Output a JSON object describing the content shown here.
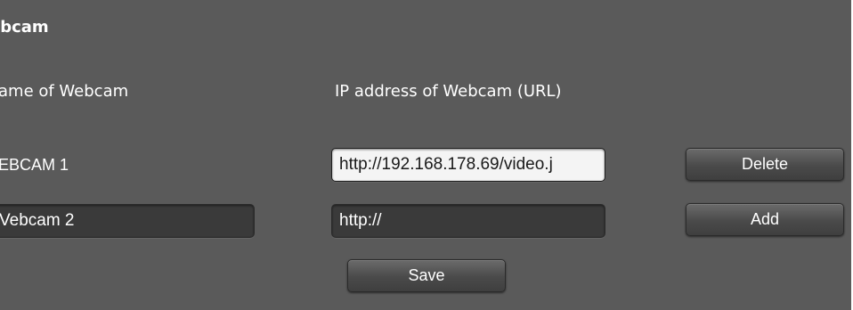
{
  "section": {
    "title": "ebcam"
  },
  "columns": {
    "name_header": "ame of Webcam",
    "url_header": "IP address of Webcam (URL)"
  },
  "rows": [
    {
      "name": "EBCAM 1",
      "url": "http://192.168.178.69/video.j",
      "action": "Delete"
    },
    {
      "name": "Vebcam 2",
      "url": "http://",
      "action": "Add"
    }
  ],
  "save_label": "Save",
  "colors": {
    "panel_bg": "#5a5a5a",
    "field_bg": "#3a3a3a",
    "text": "#ffffff"
  }
}
